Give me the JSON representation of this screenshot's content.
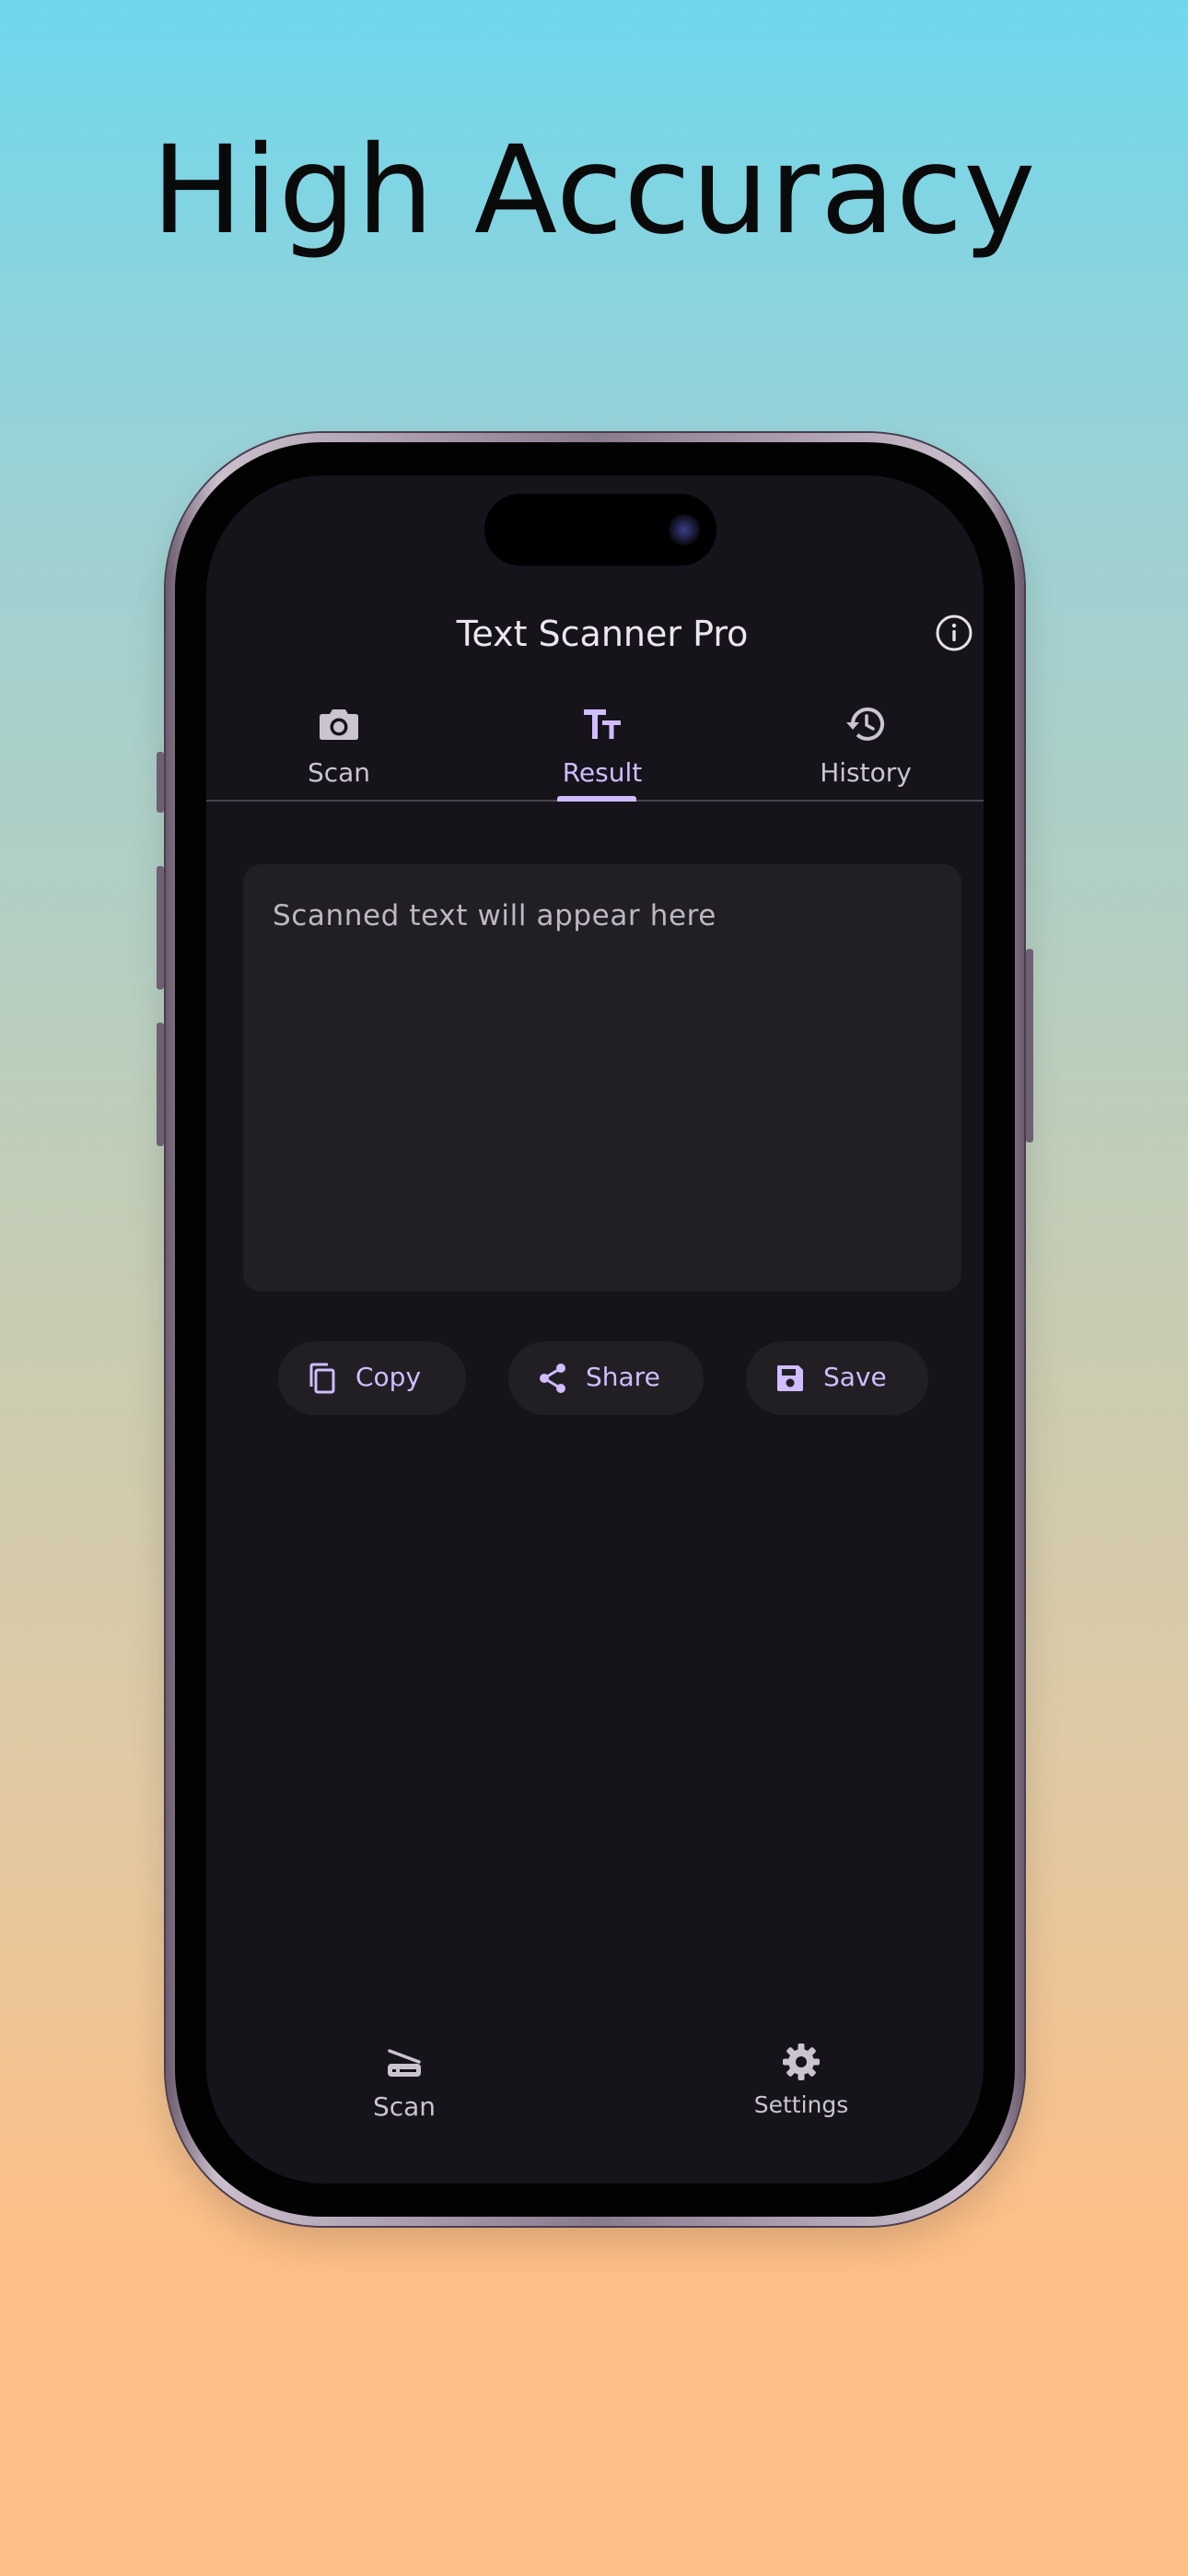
{
  "headline": "High Accuracy",
  "app": {
    "title": "Text Scanner Pro"
  },
  "tabs": [
    {
      "label": "Scan",
      "icon": "camera-icon"
    },
    {
      "label": "Result",
      "icon": "text-fields-icon",
      "active": true
    },
    {
      "label": "History",
      "icon": "history-icon"
    }
  ],
  "result": {
    "placeholder": "Scanned text will appear here"
  },
  "actions": {
    "copy_label": "Copy",
    "share_label": "Share",
    "save_label": "Save"
  },
  "bottom_nav": {
    "scan_label": "Scan",
    "settings_label": "Settings"
  },
  "colors": {
    "accent": "#d0bcff",
    "surface": "#16131b",
    "card": "#211f24",
    "text_secondary": "#cac4d0"
  }
}
